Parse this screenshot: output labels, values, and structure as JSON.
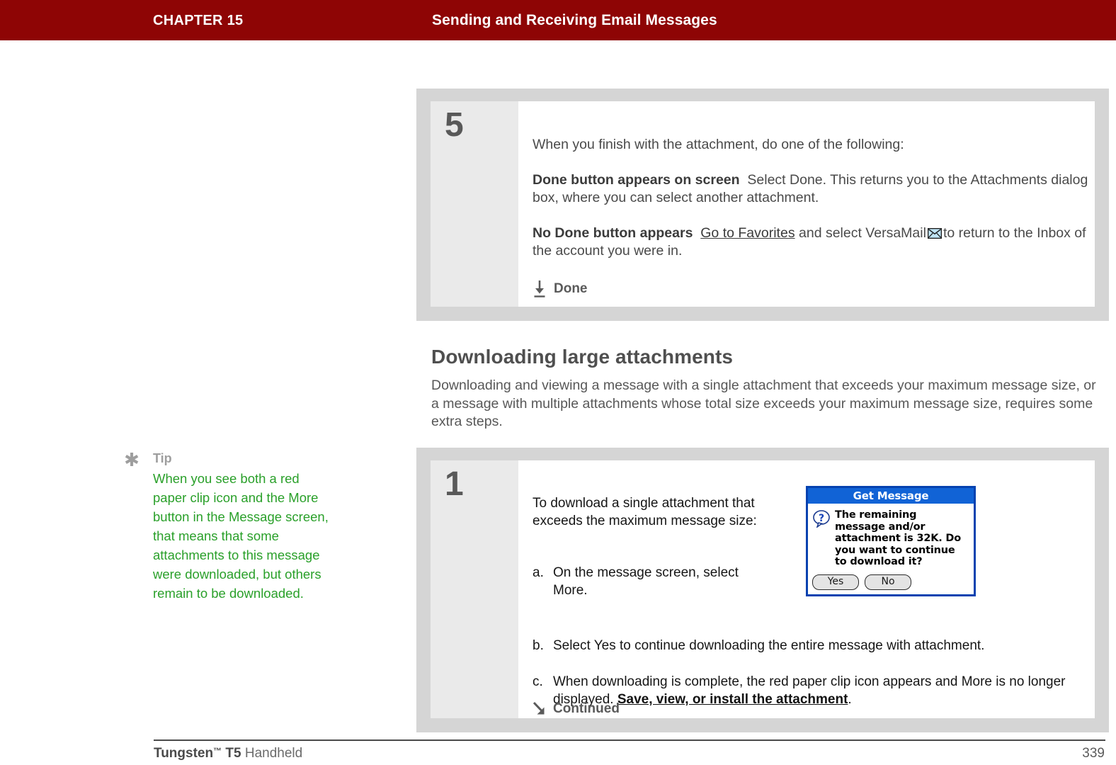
{
  "header": {
    "chapter": "CHAPTER 15",
    "title": "Sending and Receiving Email Messages",
    "bg_color": "#8E0505",
    "text_color": "#FFFFFF"
  },
  "step5": {
    "number": "5",
    "intro": "When you finish with the attachment, do one of the following:",
    "option1_lead": "Done button appears on screen",
    "option1_text": "Select Done. This returns you to the Attachments dialog box, where you can select another attachment.",
    "option2_lead": "No Done button appears",
    "option2_link": "Go to Favorites",
    "option2_text_a": "and select VersaMail",
    "option2_icon": "envelope-icon",
    "option2_text_b": "to return to the Inbox of the account you were in.",
    "footer_icon": "arrow-down-icon",
    "footer_label": "Done"
  },
  "section": {
    "heading": "Downloading large attachments",
    "intro": "Downloading and viewing a message with a single attachment that exceeds your maximum message size, or a message with multiple attachments whose total size exceeds your maximum message size, requires some extra steps."
  },
  "step1": {
    "number": "1",
    "intro": "To download a single attachment that exceeds the maximum message size:",
    "items": [
      {
        "marker": "a.",
        "text": "On the message screen, select More."
      },
      {
        "marker": "b.",
        "text": "Select Yes to continue downloading the entire message with attachment."
      }
    ],
    "item_c": {
      "marker": "c.",
      "text_a": "When downloading is complete, the red paper clip icon appears and More is no longer displayed.",
      "link": "Save, view, or install the attachment",
      "text_b": "."
    },
    "footer_icon": "arrow-down-right-icon",
    "footer_label": "Continued"
  },
  "dialog": {
    "title": "Get Message",
    "icon": "question-bubble-icon",
    "message": "The remaining message and/or attachment is 32K. Do you want to continue to download it?",
    "buttons": [
      "Yes",
      "No"
    ],
    "title_bg": "#1163D6",
    "border_color": "#0542B0"
  },
  "tip": {
    "icon": "asterisk-icon",
    "label": "Tip",
    "body": "When you see both a red paper clip icon and the More button in the Message screen, that means that some attachments to this message were downloaded, but others remain to be downloaded.",
    "text_color": "#2AA02A"
  },
  "footer": {
    "product_strong": "Tungsten",
    "product_tm": "™",
    "product_model": "T5",
    "product_rest": "Handheld",
    "page_number": "339"
  }
}
